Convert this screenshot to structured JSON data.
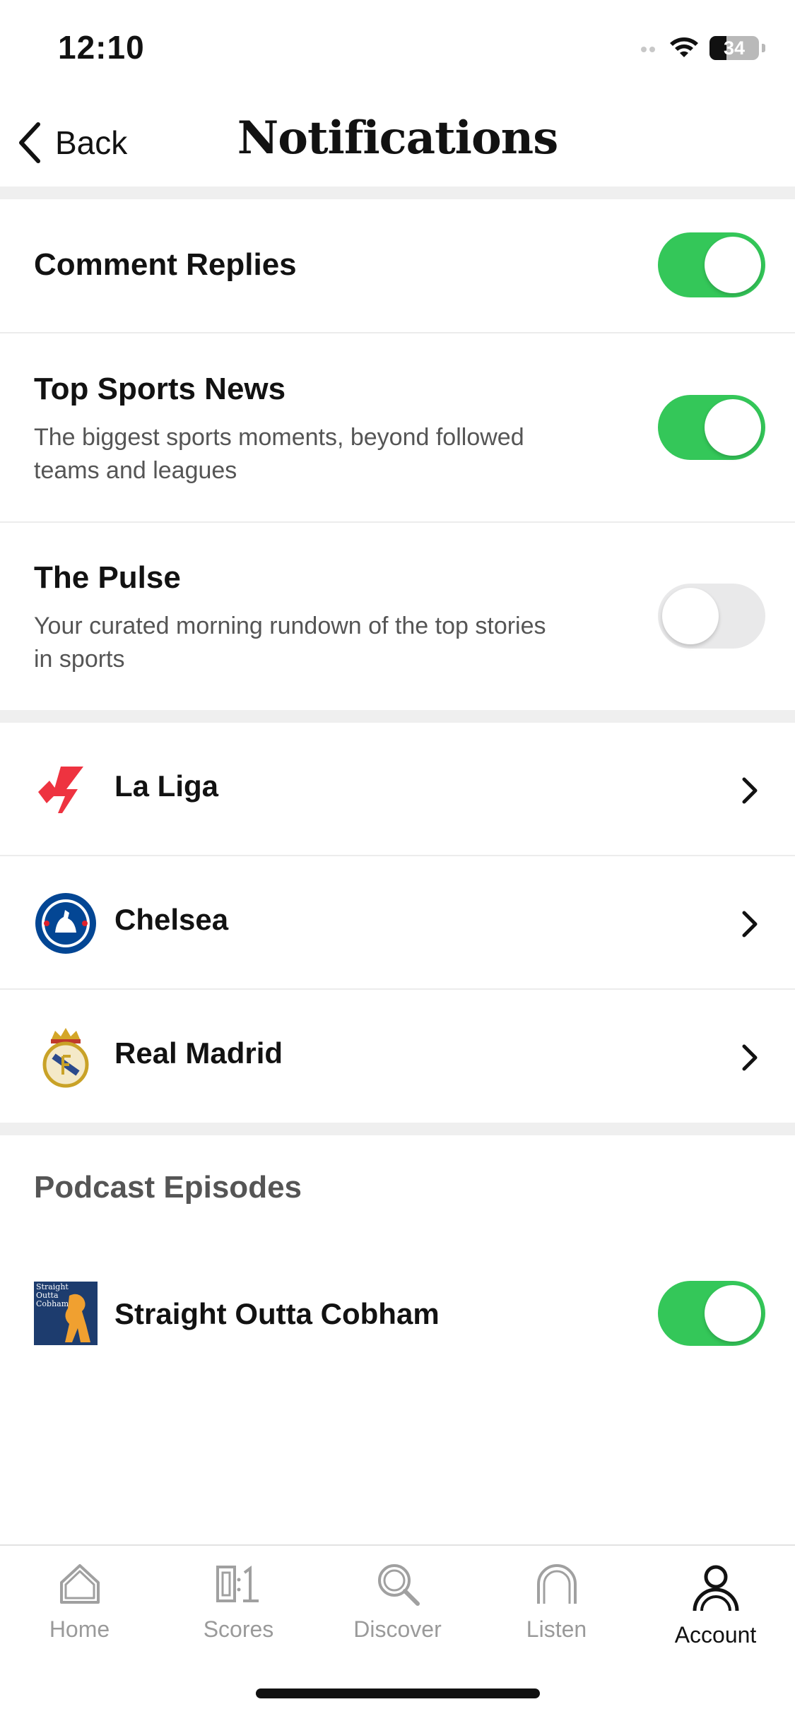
{
  "status_bar": {
    "time": "12:10",
    "battery": "34",
    "battery_level": 0.34,
    "signal_icon": "cellular-signal-icon",
    "wifi_icon": "wifi-icon"
  },
  "nav": {
    "back_label": "Back",
    "title": "Notifications",
    "back_icon": "chevron-left-icon"
  },
  "settings": [
    {
      "title": "Comment Replies",
      "subtitle": "",
      "enabled": true
    },
    {
      "title": "Top Sports News",
      "subtitle": "The biggest sports moments, beyond followed teams and leagues",
      "enabled": true
    },
    {
      "title": "The Pulse",
      "subtitle": "Your curated morning rundown of the top stories in sports",
      "enabled": false
    }
  ],
  "teams": [
    {
      "name": "La Liga",
      "logo_icon": "laliga-logo-icon"
    },
    {
      "name": "Chelsea",
      "logo_icon": "chelsea-crest-icon"
    },
    {
      "name": "Real Madrid",
      "logo_icon": "real-madrid-crest-icon"
    }
  ],
  "podcast_section": {
    "header": "Podcast Episodes",
    "items": [
      {
        "name": "Straight Outta Cobham",
        "art_text": "Straight Outta Cobham",
        "enabled": true
      }
    ]
  },
  "tab_bar": {
    "tabs": [
      {
        "label": "Home",
        "icon": "home-icon",
        "active": false
      },
      {
        "label": "Scores",
        "icon": "scores-icon",
        "active": false
      },
      {
        "label": "Discover",
        "icon": "search-icon",
        "active": false
      },
      {
        "label": "Listen",
        "icon": "listen-icon",
        "active": false
      },
      {
        "label": "Account",
        "icon": "account-icon",
        "active": true
      }
    ]
  },
  "colors": {
    "toggle_on": "#34c759",
    "toggle_off": "#e9e9ea",
    "band": "#efefef",
    "laliga_red": "#ee3340",
    "chelsea_blue": "#034694"
  }
}
